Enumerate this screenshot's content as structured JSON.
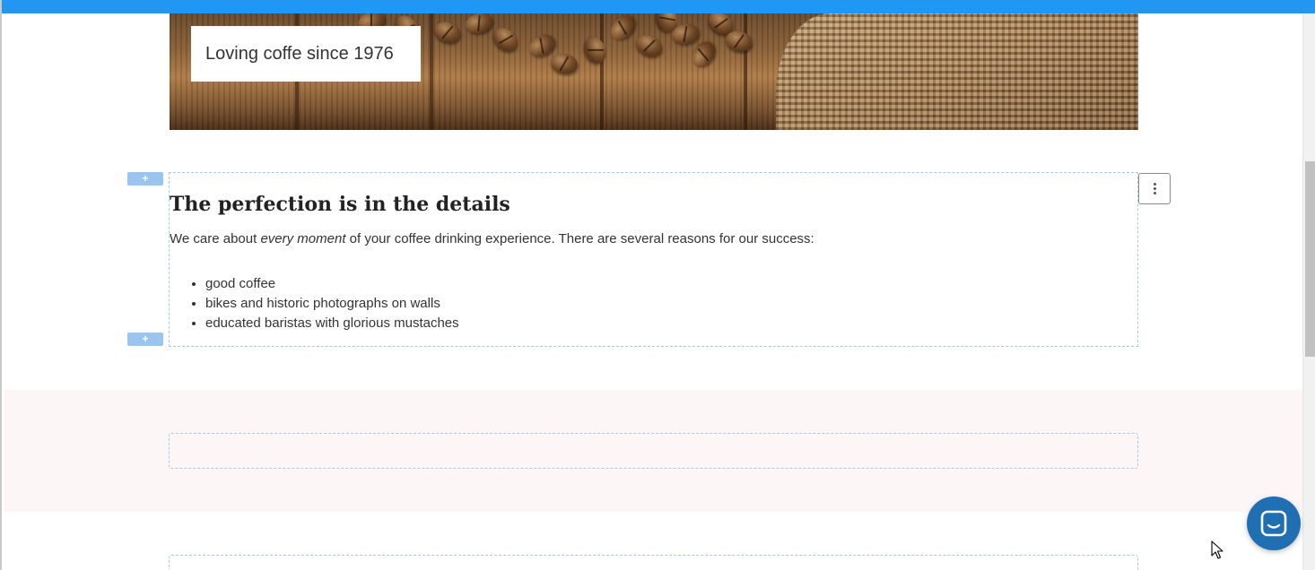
{
  "hero": {
    "caption": "Loving coffe since 1976"
  },
  "content_block": {
    "heading": "The perfection is in the details",
    "intro_before": "We care about ",
    "intro_emphasis": "every moment",
    "intro_after": " of your coffee drinking experience. There are several reasons for our success:",
    "reasons": [
      "good coffee",
      "bikes and historic photographs on walls",
      "educated baristas with glorious mustaches"
    ],
    "add_above_label": "+",
    "add_below_label": "+"
  },
  "colors": {
    "top_bar": "#2196f3",
    "block_border": "#a9c8e8",
    "add_button": "#9ac5ee",
    "pink_section": "#fdf6f6",
    "chat_launcher": "#1f6fb2"
  },
  "icons": {
    "menu": "more-vertical-icon",
    "chat": "chat-icon",
    "cursor": "mouse-cursor-icon"
  }
}
